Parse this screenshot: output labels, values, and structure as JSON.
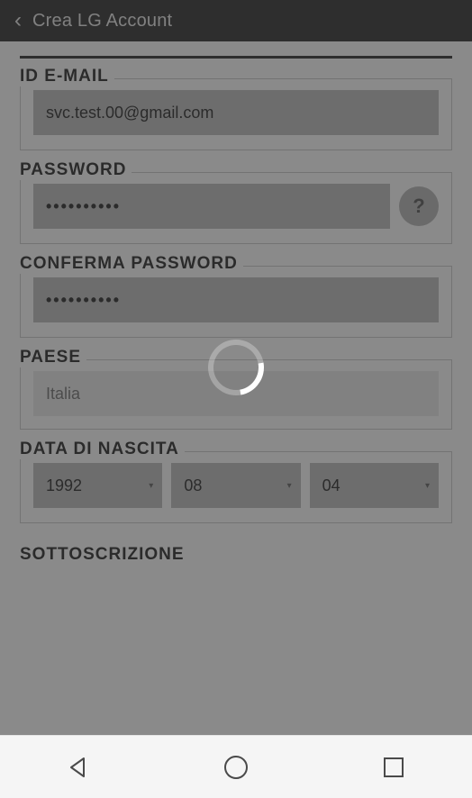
{
  "header": {
    "title": "Crea LG Account"
  },
  "form": {
    "email": {
      "label": "ID E-MAIL",
      "value": "svc.test.00@gmail.com"
    },
    "password": {
      "label": "PASSWORD",
      "masked_value": "••••••••••",
      "help_icon_text": "?"
    },
    "confirm_password": {
      "label": "CONFERMA PASSWORD",
      "masked_value": "••••••••••"
    },
    "country": {
      "label": "PAESE",
      "value": "Italia"
    },
    "dob": {
      "label": "DATA DI NASCITA",
      "year": "1992",
      "month": "08",
      "day": "04"
    },
    "subscription": {
      "label": "SOTTOSCRIZIONE"
    }
  },
  "state": {
    "loading": true
  },
  "icons": {
    "back_chevron": "‹",
    "dropdown_triangle": "▾"
  }
}
